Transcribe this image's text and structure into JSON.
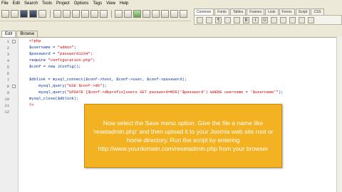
{
  "menu": [
    "File",
    "Edit",
    "Search",
    "Tools",
    "Project",
    "Options",
    "Tags",
    "View",
    "Help"
  ],
  "right_tabs": [
    "Common",
    "Fonts",
    "Tables",
    "Frames",
    "Lists",
    "Forms",
    "Script",
    "CSS"
  ],
  "file_tabs": [
    "Edit",
    "Browse"
  ],
  "line_numbers": [
    "1",
    "2",
    "3",
    "4",
    "5",
    "6",
    "7",
    "8",
    "9",
    "10",
    "11",
    "12"
  ],
  "code": {
    "l1": "<?php",
    "l2a": "$username = ",
    "l2b": "\"admin\";",
    "l3a": "$password = ",
    "l3b": "\"password1234\";",
    "l4a": "require ",
    "l4b": "\"configuration.php\";",
    "l5": "$conf = new JConfig();",
    "l6": "",
    "l7": "$dblink = mysql_connect($conf->host, $conf->user, $conf->password);",
    "l8a": "    mysql_query(",
    "l8b": "\"USE $conf->db\"",
    "l8c": ");",
    "l9a": "    mysql_query(",
    "l9b": "\"UPDATE {$conf->dbprefix}users SET password=MD5('$password') WHERE username = '$username'\"",
    "l9c": ");",
    "l10": "mysql_close($dblink);",
    "l11": "?>"
  },
  "tooltip": "Now select the Save menu option. Give the file a name like 'resetadmin.php' and then upload it to your Joomla web site root or home directory.  Run the script by entering http://www.yourdomain.com/resetadmin.php from your browser",
  "colors": {
    "tooltip_bg": "#f2b221",
    "editor_bg": "#ffffff",
    "chrome_bg": "#ece9d8"
  }
}
